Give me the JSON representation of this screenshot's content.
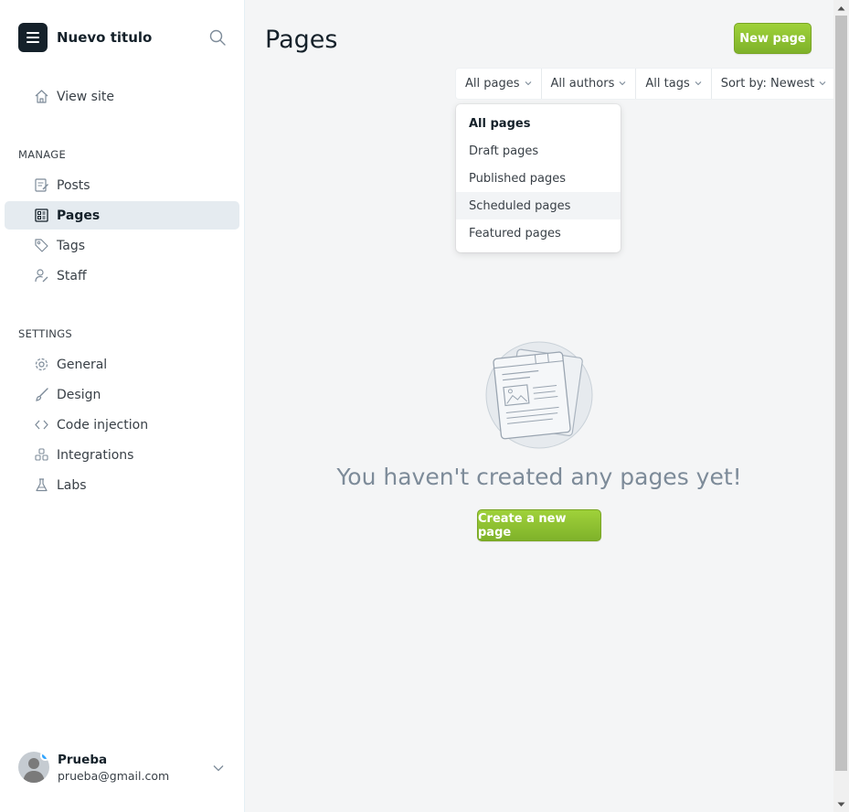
{
  "sidebar": {
    "brand_title": "Nuevo titulo",
    "view_site": "View site",
    "manage_heading": "MANAGE",
    "manage_items": [
      {
        "label": "Posts",
        "icon": "posts-icon"
      },
      {
        "label": "Pages",
        "icon": "pages-icon",
        "active": true
      },
      {
        "label": "Tags",
        "icon": "tag-icon"
      },
      {
        "label": "Staff",
        "icon": "staff-icon"
      }
    ],
    "settings_heading": "SETTINGS",
    "settings_items": [
      {
        "label": "General",
        "icon": "gear-icon"
      },
      {
        "label": "Design",
        "icon": "brush-icon"
      },
      {
        "label": "Code injection",
        "icon": "code-icon"
      },
      {
        "label": "Integrations",
        "icon": "integrations-icon"
      },
      {
        "label": "Labs",
        "icon": "flask-icon"
      }
    ],
    "user": {
      "name": "Prueba",
      "email": "prueba@gmail.com"
    }
  },
  "main": {
    "title": "Pages",
    "new_page_label": "New page",
    "filters": [
      {
        "label": "All pages"
      },
      {
        "label": "All authors"
      },
      {
        "label": "All tags"
      },
      {
        "label": "Sort by: Newest"
      }
    ],
    "dropdown": {
      "options": [
        "All pages",
        "Draft pages",
        "Published pages",
        "Scheduled pages",
        "Featured pages"
      ],
      "selected": "All pages",
      "hovered": "Scheduled pages"
    },
    "empty_message": "You haven't created any pages yet!",
    "create_label": "Create a new page"
  },
  "colors": {
    "accent_green": "#8cc63f",
    "sidebar_active_bg": "#e5ebf0",
    "main_bg": "#f4f5f6"
  }
}
